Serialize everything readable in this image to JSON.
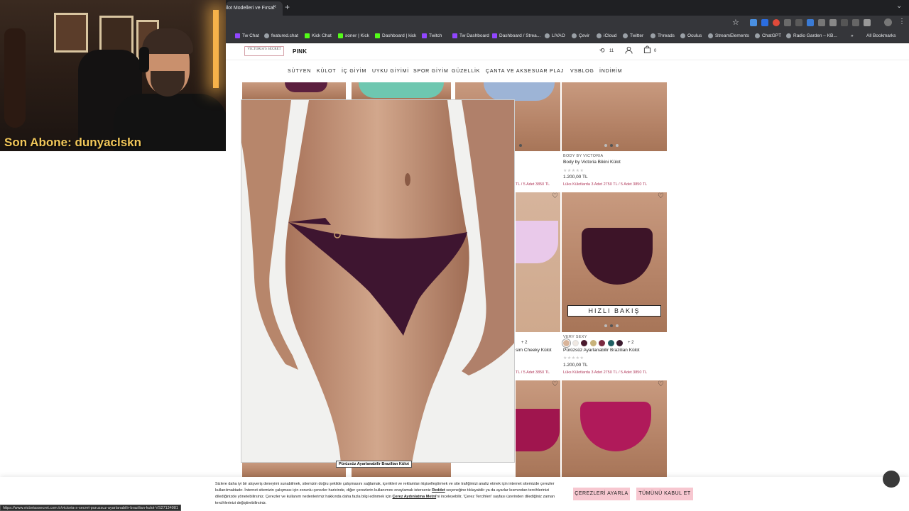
{
  "browser": {
    "tab_title": "ilot Modelleri ve Fırsat",
    "tab_close": "×",
    "new_tab": "+",
    "tab_menu": "⌄",
    "star": "☆",
    "menu": "⋮",
    "bookmarks": [
      {
        "label": "Tw Chat",
        "icon": "twitch"
      },
      {
        "label": "featured.chat",
        "icon": "globe"
      },
      {
        "label": "Kick Chat",
        "icon": "kick"
      },
      {
        "label": "soner | Kick",
        "icon": "kick"
      },
      {
        "label": "Dashboard | kick",
        "icon": "kick"
      },
      {
        "label": "Twitch",
        "icon": "twitch"
      },
      {
        "label": "Tw Dashboard",
        "icon": "twitch"
      },
      {
        "label": "Dashboard / Strea...",
        "icon": "twitch"
      },
      {
        "label": "LIVAO",
        "icon": "globe"
      },
      {
        "label": "Çevir",
        "icon": "globe"
      },
      {
        "label": "iCloud",
        "icon": "globe"
      },
      {
        "label": "Twitter",
        "icon": "globe"
      },
      {
        "label": "Threads",
        "icon": "globe"
      },
      {
        "label": "Oculus",
        "icon": "globe"
      },
      {
        "label": "StreamElements",
        "icon": "globe"
      },
      {
        "label": "ChatGPT",
        "icon": "globe"
      },
      {
        "label": "Radio Garden – KB...",
        "icon": "globe"
      }
    ],
    "bookmarks_overflow": "»",
    "all_bookmarks": "All Bookmarks",
    "status_url": "https://www.victoriassecret.com.tr/victoria-s-secret-puruzsuz-ayarlanabilir-brazilian-kulot-VS27134981"
  },
  "stream": {
    "overlay_text": "Son Abone: dunyaclskn"
  },
  "header": {
    "logo_text": "VICTORIA'S SECRET",
    "pink": "PINK",
    "compare_count": "11",
    "bag_count": "0"
  },
  "nav": [
    "SÜTYEN",
    "KÜLOT",
    "İÇ GİYİM",
    "UYKU GİYİMİ",
    "SPOR GİYİM",
    "GÜZELLİK",
    "ÇANTA VE AKSESUAR",
    "PLAJ",
    "VSBLOG",
    "İNDİRİM"
  ],
  "products": {
    "row1_right": {
      "brand": "BODY BY VICTORIA",
      "name": "Body by Victoria Bikini Külot",
      "price": "1.200,00 TL",
      "promo": "Lüks Külotlarda 3 Adet 2750 TL / 5 Adet 3850 TL"
    },
    "row1_partial_promo": "TL / 5 Adet 3850 TL",
    "row2_partial": {
      "more": "+ 2",
      "name": "sim Cheeky Külot",
      "promo": "TL / 5 Adet 3850 TL"
    },
    "row2_right": {
      "brand": "VERY SEXY",
      "name": "Pürüzsüz Ayarlanabilir Brazilian Külot",
      "price": "1.200,00 TL",
      "promo": "Lüks Külotlarda 3 Adet 2750 TL / 5 Adet 3850 TL",
      "swatches": [
        "#d8b49a",
        "#efe8e2",
        "#4a1a2e",
        "#c8b27a",
        "#7a2a40",
        "#1f5e62",
        "#3b1a2e"
      ],
      "more": "+ 2"
    },
    "stars": "★★★★★",
    "quick_view": "HIZLI BAKIŞ"
  },
  "zoom": {
    "caption": "Pürüzsüz Ayarlanabilir Brazilian Külot"
  },
  "cookie": {
    "text_1": "Sizlere daha iyi bir alışveriş deneyimi sunabilmek, sitemizin doğru şekilde çalışmasını sağlamak, içerikleri ve reklamları kişiselleştirmek ve site trafiğimizi analiz etmek için internet sitemizde çerezler kullanılmaktadır. İnternet sitemizin çalışması için zorunlu çerezler haricinde, diğer çerezlerin kullanımını onaylamak isterseniz ",
    "reject": "Reddet",
    "text_2": " seçeneğine tıklayabilir ya da ayarlar kısmından tercihlerinizi dilediğinizde yönetebilirsiniz. Çerezler ve kullanım nedenlerimiz hakkında daha fazla bilgi edinmek için ",
    "policy_link": "Çerez Aydınlatma Metni",
    "text_3": "'ni inceleyebilir, 'Çerez Tercihleri' sayfası üzerinden dilediğiniz zaman tercihlerinizi değiştirebilirsiniz.",
    "settings_button": "ÇEREZLERİ AYARLA",
    "accept_button": "TÜMÜNÜ KABUL ET"
  }
}
